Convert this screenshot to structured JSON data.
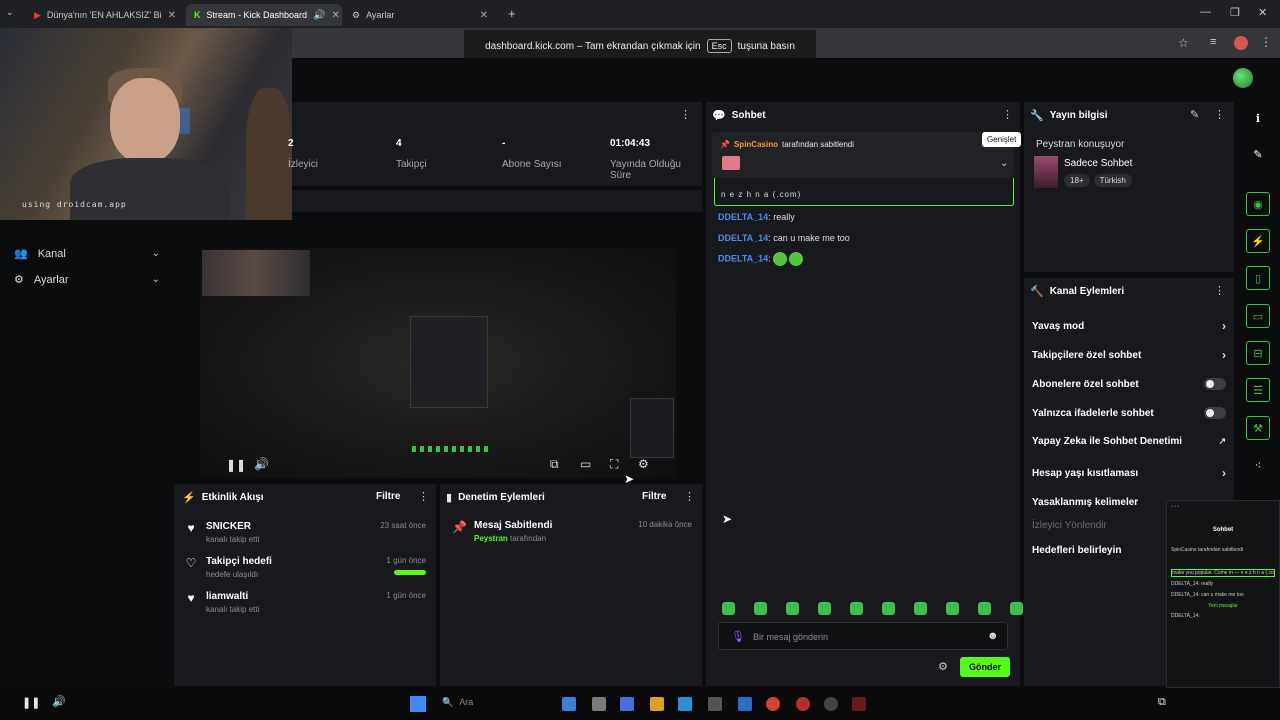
{
  "browser": {
    "tabs": [
      {
        "title": "Dünya'nın 'EN AHLAKSIZ' Bilim",
        "icon": "youtube-icon",
        "active": false
      },
      {
        "title": "Stream - Kick Dashboard",
        "icon": "kick-icon",
        "active": true
      },
      {
        "title": "Ayarlar",
        "icon": "gear-icon",
        "active": false
      }
    ],
    "fullscreen_notice": {
      "prefix": "dashboard.kick.com – Tam ekrandan çıkmak için",
      "key": "Esc",
      "suffix": "tuşuna basın"
    }
  },
  "webcam": {
    "overlay_text": "using droidcam.app"
  },
  "left_nav": [
    {
      "label": "Kanal",
      "icon": "user-group-icon"
    },
    {
      "label": "Ayarlar",
      "icon": "gear-icon"
    }
  ],
  "stats": [
    {
      "value": "2",
      "label": "İzleyici"
    },
    {
      "value": "4",
      "label": "Takipçi"
    },
    {
      "value": "-",
      "label": "Abone Sayısı"
    },
    {
      "value": "01:04:43",
      "label": "Yayında Olduğu Süre"
    }
  ],
  "activity_feed": {
    "title": "Etkinlik Akışı",
    "filter_label": "Filtre",
    "items": [
      {
        "name": "SNICKER",
        "sub": "kanalı takip etti",
        "time": "23 saat önce",
        "icon": "heart-filled-icon"
      },
      {
        "name": "Takipçi hedefi",
        "sub": "hedefe ulaşıldı",
        "time": "1 gün önce",
        "icon": "heart-outline-icon",
        "progress": 1.0
      },
      {
        "name": "liamwalti",
        "sub": "kanalı takip etti",
        "time": "1 gün önce",
        "icon": "heart-filled-icon"
      }
    ]
  },
  "moderation": {
    "title": "Denetim Eylemleri",
    "filter_label": "Filtre",
    "items": [
      {
        "name": "Mesaj Sabitlendi",
        "by_user": "Peystran",
        "by_suffix": "tarafından",
        "time": "10 dakika önce"
      }
    ]
  },
  "chat": {
    "title": "Sohbet",
    "pinned": {
      "user": "SpinCasino",
      "suffix": "tarafından sabitlendi"
    },
    "expand_tooltip": "Genişlet",
    "partial_message": "n e z h n a (.com)",
    "messages": [
      {
        "user": "DDELTA_14",
        "text": "really"
      },
      {
        "user": "DDELTA_14",
        "text": "can u make me too"
      },
      {
        "user": "DDELTA_14",
        "text": ""
      }
    ],
    "input_placeholder": "Bir mesaj gönderin",
    "send_label": "Gönder"
  },
  "stream_info": {
    "title": "Yayın bilgisi",
    "topic_prefix": "Peystran konuşuyor",
    "category": "Sadece Sohbet",
    "tags": [
      "18+",
      "Türkish"
    ]
  },
  "channel_actions": {
    "title": "Kanal Eylemleri",
    "items": [
      {
        "label": "Yavaş mod",
        "control": "arrow"
      },
      {
        "label": "Takipçilere özel sohbet",
        "control": "arrow"
      },
      {
        "label": "Abonelere özel sohbet",
        "control": "toggle",
        "on": false
      },
      {
        "label": "Yalnızca ifadelerle sohbet",
        "control": "toggle",
        "on": false
      },
      {
        "label": "Yapay Zeka ile Sohbet Denetimi",
        "control": "external"
      },
      {
        "label": "Hesap yaşı kısıtlaması",
        "control": "arrow"
      },
      {
        "label": "Yasaklanmış kelimeler",
        "control": "arrow"
      },
      {
        "label": "İzleyici Yönlendir",
        "control": "none",
        "disabled": true
      },
      {
        "label": "Hedefleri belirleyin",
        "control": "none"
      }
    ]
  },
  "mini_overlay": {
    "header": "Sohbet",
    "lines": [
      "SpinCasino tarafından sabitlendi",
      "make you popular. Come in — n e z h n a (.com)",
      "DDELTA_14: really",
      "DDELTA_14: can u make me too",
      "Yeni mesajlar",
      "DDELTA_14:"
    ]
  },
  "taskbar": {
    "search_placeholder": "Ara"
  },
  "colors": {
    "accent": "#53fc18",
    "panel": "#18191c",
    "bg": "#0b0c0e",
    "link": "#4a8df0"
  }
}
